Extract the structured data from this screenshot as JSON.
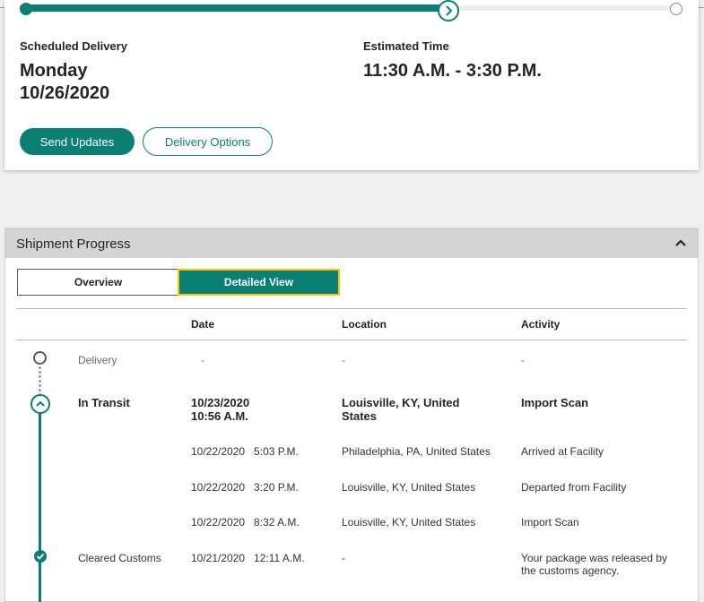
{
  "delivery": {
    "scheduled_label": "Scheduled Delivery",
    "day": "Monday",
    "date": "10/26/2020",
    "estimated_label": "Estimated Time",
    "time_window": "11:30 A.M. - 3:30 P.M.",
    "send_updates_label": "Send Updates",
    "delivery_options_label": "Delivery Options"
  },
  "shipment": {
    "title": "Shipment Progress",
    "tabs": {
      "overview": "Overview",
      "detailed": "Detailed View",
      "active": "detailed"
    },
    "columns": {
      "date": "Date",
      "location": "Location",
      "activity": "Activity"
    },
    "rows": [
      {
        "status": "Delivery",
        "date": "-",
        "location": "-",
        "activity": "-"
      },
      {
        "status": "In Transit",
        "date_line1": "10/23/2020",
        "date_line2": "10:56 A.M.",
        "location_line1": "Louisville, KY, United",
        "location_line2": "States",
        "activity": "Import Scan"
      },
      {
        "status": "",
        "date": "10/22/2020   5:03 P.M.",
        "location": "Philadelphia, PA, United States",
        "activity": "Arrived at Facility"
      },
      {
        "status": "",
        "date": "10/22/2020   3:20 P.M.",
        "location": "Louisville, KY, United States",
        "activity": "Departed from Facility"
      },
      {
        "status": "",
        "date": "10/22/2020   8:32 A.M.",
        "location": "Louisville, KY, United States",
        "activity": "Import Scan"
      },
      {
        "status": "Cleared Customs",
        "date": "10/21/2020   12:11 A.M.",
        "location": "-",
        "activity_line1": "Your package was released by",
        "activity_line2": "the customs agency."
      }
    ]
  },
  "colors": {
    "accent": "#0a8074",
    "focus": "#ffc400",
    "header_bg": "#d4d4d4"
  }
}
